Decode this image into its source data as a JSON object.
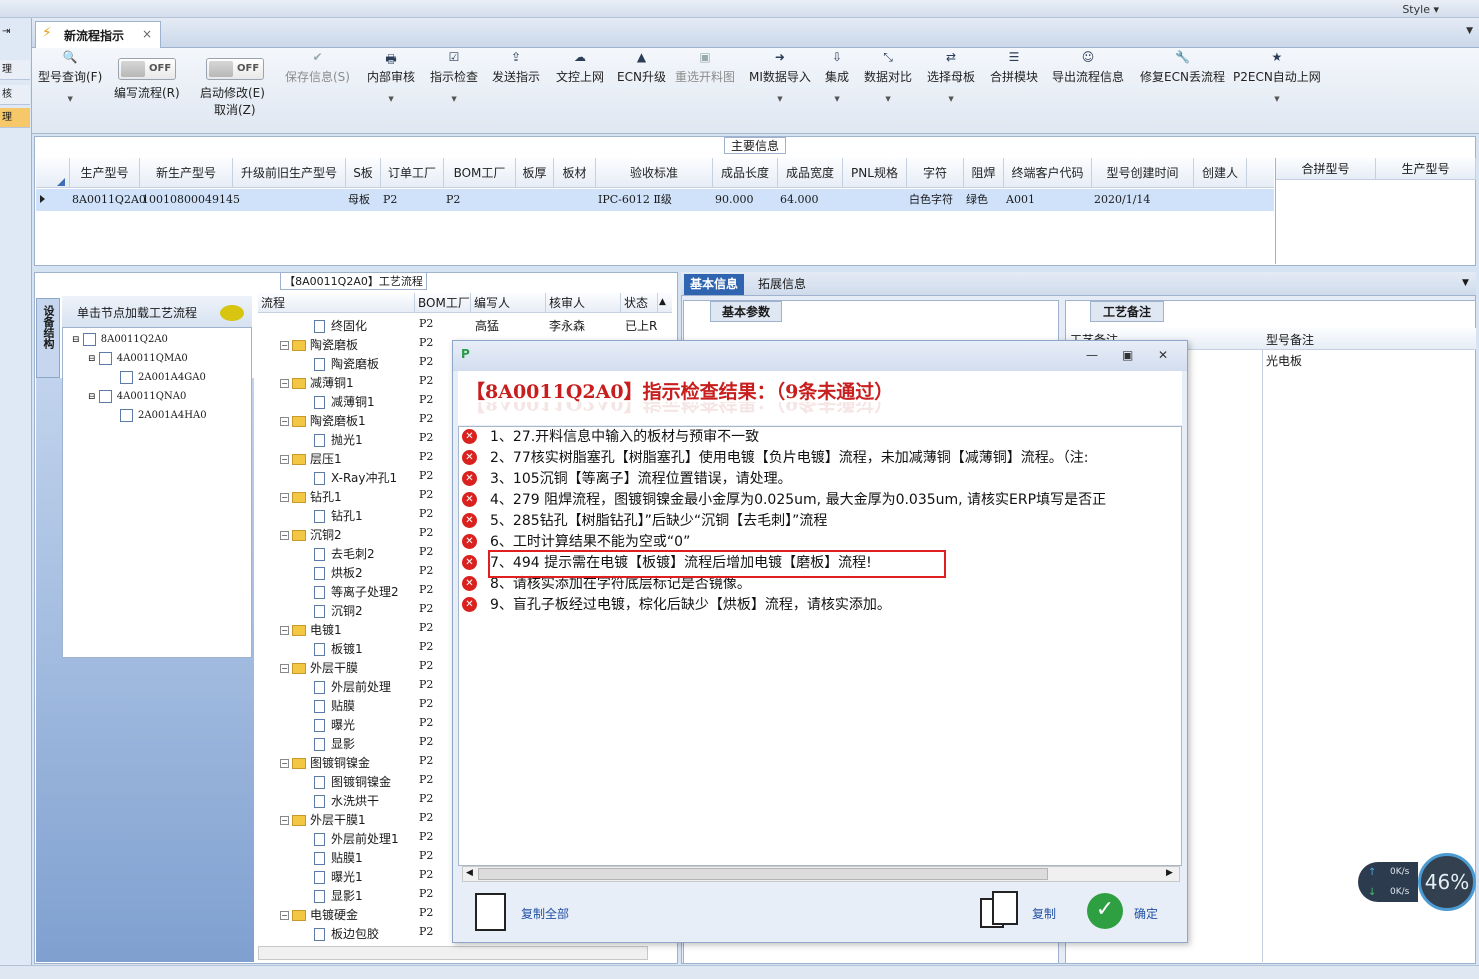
{
  "window": {
    "style_label": "Style"
  },
  "tab": {
    "title": "新流程指示",
    "close": "×"
  },
  "left_nav": [
    "理",
    "核",
    "理"
  ],
  "toolbar": {
    "items": [
      {
        "label": "型号查询(F)",
        "icon": "🔍"
      },
      {
        "label": "编写流程(R)"
      },
      {
        "label": "启动修改(E)",
        "label2": "取消(Z)"
      },
      {
        "label": "保存信息(S)",
        "icon": "✔"
      },
      {
        "label": "内部审核",
        "icon": "🖶"
      },
      {
        "label": "指示检查",
        "icon": "☑"
      },
      {
        "label": "发送指示",
        "icon": "⇪"
      },
      {
        "label": "文控上网",
        "icon": "☁"
      },
      {
        "label": "ECN升级",
        "icon": "▲"
      },
      {
        "label": "重选开料图",
        "icon": "▣"
      },
      {
        "label": "MI数据导入",
        "icon": "➜"
      },
      {
        "label": "集成",
        "icon": "⇩"
      },
      {
        "label": "数据对比",
        "icon": "⤡"
      },
      {
        "label": "选择母板",
        "icon": "⇄"
      },
      {
        "label": "合拼模块",
        "icon": "☰"
      },
      {
        "label": "导出流程信息",
        "icon": "☺"
      },
      {
        "label": "修复ECN丢流程",
        "icon": "🔧"
      },
      {
        "label": "P2ECN自动上网",
        "icon": "★"
      }
    ],
    "toggle_off": "OFF"
  },
  "main_info": {
    "label": "主要信息",
    "columns": [
      "生产型号",
      "新生产型号",
      "升级前旧生产型号",
      "S板",
      "订单工厂",
      "BOM工厂",
      "板厚",
      "板材",
      "验收标准",
      "成品长度",
      "成品宽度",
      "PNL规格",
      "字符",
      "阻焊",
      "终端客户代码",
      "型号创建时间",
      "创建人"
    ],
    "row": [
      "8A0011Q2A0",
      "10010800049145",
      "",
      "母板",
      "P2",
      "P2",
      "",
      "",
      "IPC-6012 Ⅱ级",
      "90.000",
      "64.000",
      "",
      "白色字符",
      "绿色",
      "A001",
      "2020/1/14",
      ""
    ],
    "merge_columns": [
      "合拼型号",
      "生产型号"
    ]
  },
  "side": {
    "tab_label": "设备结构",
    "tree_header": "单击节点加载工艺流程",
    "nodes": [
      "8A0011Q2A0",
      "4A0011QMA0",
      "2A001A4GA0",
      "4A0011QNA0",
      "2A001A4HA0"
    ]
  },
  "process": {
    "title": "【8A0011Q2A0】工艺流程",
    "columns": [
      "流程",
      "BOM工厂",
      "编写人",
      "核审人",
      "状态"
    ],
    "rows": [
      {
        "name": "终固化",
        "level": 1,
        "bom": "P2",
        "writer": "高猛",
        "reviewer": "李永森",
        "status": "已上R"
      },
      {
        "name": "陶瓷磨板",
        "level": 0,
        "bom": "P2"
      },
      {
        "name": "陶瓷磨板",
        "level": 1,
        "bom": "P2"
      },
      {
        "name": "减薄铜1",
        "level": 0,
        "bom": "P2"
      },
      {
        "name": "减薄铜1",
        "level": 1,
        "bom": "P2"
      },
      {
        "name": "陶瓷磨板1",
        "level": 0,
        "bom": "P2"
      },
      {
        "name": "抛光1",
        "level": 1,
        "bom": "P2"
      },
      {
        "name": "层压1",
        "level": 0,
        "bom": "P2"
      },
      {
        "name": "X-Ray冲孔1",
        "level": 1,
        "bom": "P2"
      },
      {
        "name": "钻孔1",
        "level": 0,
        "bom": "P2"
      },
      {
        "name": "钻孔1",
        "level": 1,
        "bom": "P2"
      },
      {
        "name": "沉铜2",
        "level": 0,
        "bom": "P2"
      },
      {
        "name": "去毛刺2",
        "level": 1,
        "bom": "P2"
      },
      {
        "name": "烘板2",
        "level": 1,
        "bom": "P2"
      },
      {
        "name": "等离子处理2",
        "level": 1,
        "bom": "P2"
      },
      {
        "name": "沉铜2",
        "level": 1,
        "bom": "P2"
      },
      {
        "name": "电镀1",
        "level": 0,
        "bom": "P2"
      },
      {
        "name": "板镀1",
        "level": 1,
        "bom": "P2"
      },
      {
        "name": "外层干膜",
        "level": 0,
        "bom": "P2"
      },
      {
        "name": "外层前处理",
        "level": 1,
        "bom": "P2"
      },
      {
        "name": "贴膜",
        "level": 1,
        "bom": "P2"
      },
      {
        "name": "曝光",
        "level": 1,
        "bom": "P2"
      },
      {
        "name": "显影",
        "level": 1,
        "bom": "P2"
      },
      {
        "name": "图镀铜镍金",
        "level": 0,
        "bom": "P2"
      },
      {
        "name": "图镀铜镍金",
        "level": 1,
        "bom": "P2"
      },
      {
        "name": "水洗烘干",
        "level": 1,
        "bom": "P2"
      },
      {
        "name": "外层干膜1",
        "level": 0,
        "bom": "P2"
      },
      {
        "name": "外层前处理1",
        "level": 1,
        "bom": "P2"
      },
      {
        "name": "贴膜1",
        "level": 1,
        "bom": "P2"
      },
      {
        "name": "曝光1",
        "level": 1,
        "bom": "P2"
      },
      {
        "name": "显影1",
        "level": 1,
        "bom": "P2"
      },
      {
        "name": "电镀硬金",
        "level": 0,
        "bom": "P2"
      },
      {
        "name": "板边包胶",
        "level": 1,
        "bom": "P2"
      }
    ]
  },
  "right": {
    "tabs": [
      "基本信息",
      "拓展信息"
    ],
    "basic_params": "基本参数",
    "process_notes": "工艺备注",
    "notes_col1": "工艺备注",
    "notes_col2": "型号备注",
    "model_note": "光电板"
  },
  "dialog": {
    "title": "【8A0011Q2A0】指示检查结果：（9条未通过）",
    "errors": [
      "1、27.开料信息中输入的板材与预审不一致",
      "2、77核实树脂塞孔【树脂塞孔】使用电镀【负片电镀】流程，未加减薄铜【减薄铜】流程。（注:",
      "3、105沉铜【等离子】流程位置错误，请处理。",
      "4、279 阻焊流程，图镀铜镍金最小金厚为0.025um, 最大金厚为0.035um, 请核实ERP填写是否正",
      "5、285钻孔【树脂钻孔】”后缺少“沉铜【去毛刺】”流程",
      "6、工时计算结果不能为空或“0”",
      "7、494 提示需在电镀【板镀】流程后增加电镀【磨板】流程!",
      "8、请核实添加在字符底层标记是否镜像。",
      "9、盲孔子板经过电镀，棕化后缺少【烘板】流程，请核实添加。"
    ],
    "copy_all": "复制全部",
    "copy": "复制",
    "confirm": "确定"
  },
  "net": {
    "up": "0K/s",
    "down": "0K/s",
    "percent": "46%"
  }
}
